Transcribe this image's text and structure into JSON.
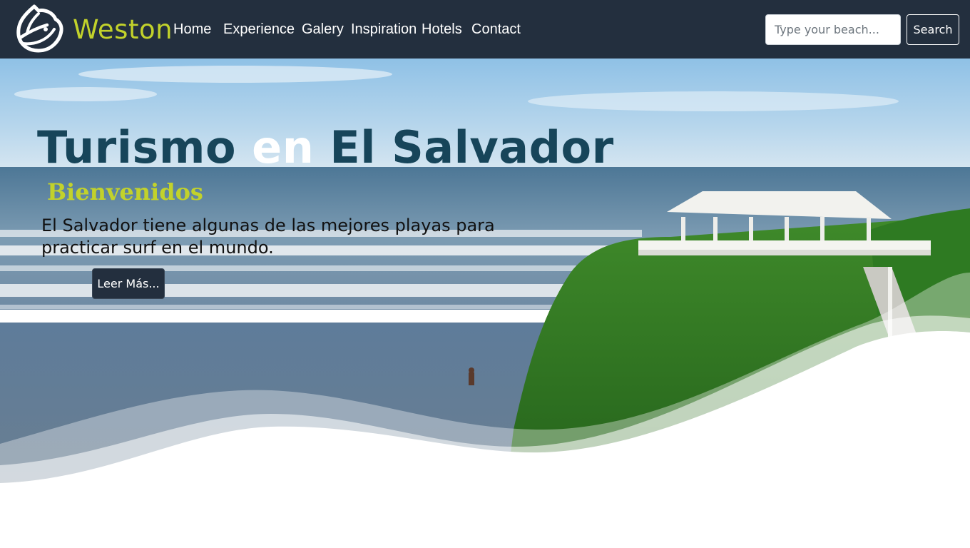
{
  "navbar": {
    "brand_name": "Weston",
    "links": [
      "Home",
      "Experience",
      "Galery",
      "Inspiration",
      "Hotels",
      "Contact"
    ],
    "search_placeholder": "Type your beach...",
    "search_button": "Search"
  },
  "hero": {
    "title_part1": "Turismo ",
    "title_accent": "en",
    "title_part2": " El Salvador",
    "subtitle": "Bienvenidos",
    "text": "El Salvador tiene algunas de las mejores playas para practicar surf en el mundo.",
    "button": "Leer Más..."
  },
  "colors": {
    "navbar_bg": "#232f3e",
    "brand_accent": "#c2d22b",
    "title": "#17455a",
    "button_bg": "#232f3e"
  },
  "icons": {
    "brand_logo": "leaf-logo-icon"
  }
}
